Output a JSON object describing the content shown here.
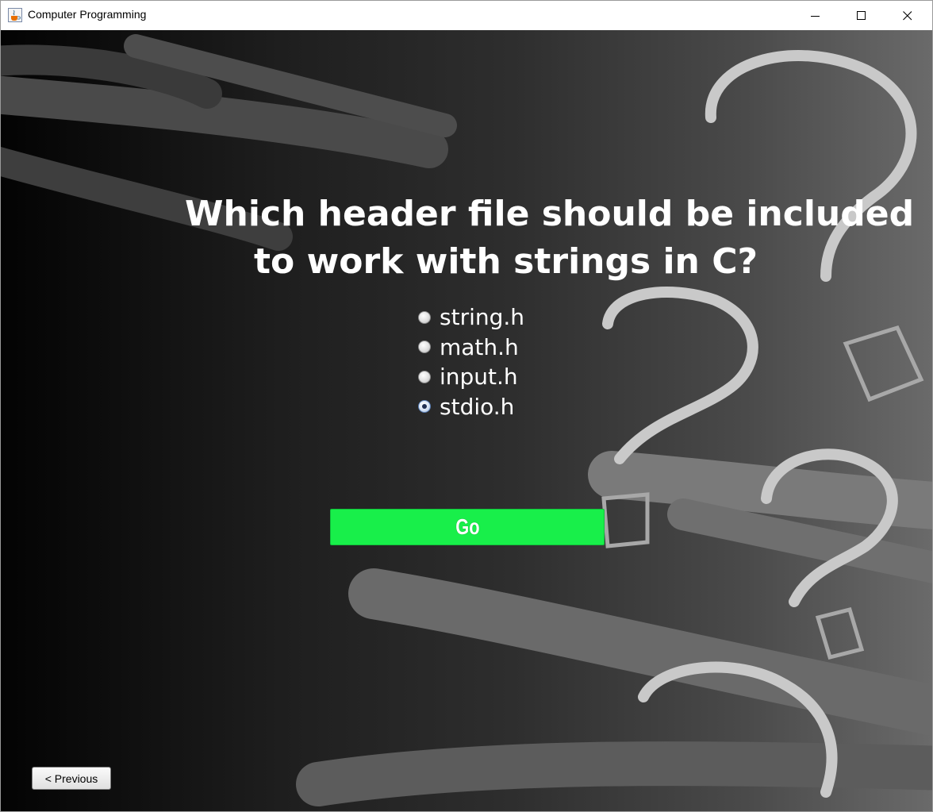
{
  "window": {
    "title": "Computer Programming",
    "app_icon": "java-cup-icon",
    "controls": [
      "minimize-icon",
      "maximize-icon",
      "close-icon"
    ]
  },
  "quiz": {
    "question_line1": "Which header file should be included",
    "question_line2": "to work with strings in C?",
    "options": [
      {
        "label": "string.h",
        "selected": false
      },
      {
        "label": "math.h",
        "selected": false
      },
      {
        "label": "input.h",
        "selected": false
      },
      {
        "label": "stdio.h",
        "selected": true
      }
    ],
    "go_label": "Go",
    "previous_label": "< Previous"
  },
  "colors": {
    "go_button": "#18ef4a",
    "question_text": "#ffffff",
    "background_dark": "#030303",
    "background_light": "#6a6a6a"
  }
}
